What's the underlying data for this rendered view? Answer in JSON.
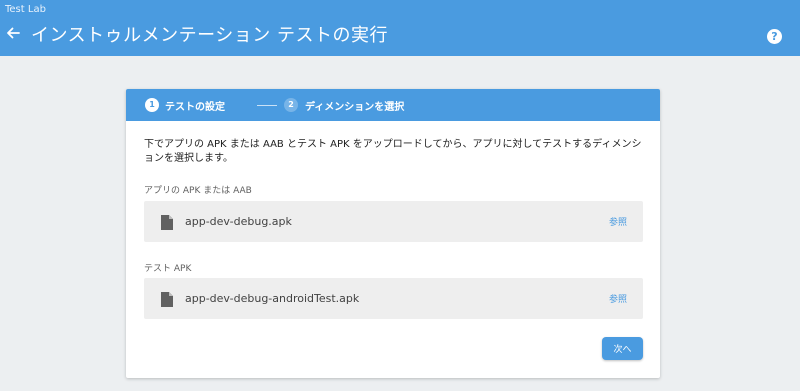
{
  "app": {
    "name": "Test Lab"
  },
  "header": {
    "title": "インストゥルメンテーション テストの実行",
    "back_icon": "arrow-left-icon",
    "help_icon": "help-icon",
    "help_glyph": "?"
  },
  "stepper": {
    "steps": [
      {
        "number": "1",
        "label": "テストの設定",
        "state": "active"
      },
      {
        "number": "2",
        "label": "ディメンションを選択",
        "state": "inactive"
      }
    ]
  },
  "form": {
    "description": "下でアプリの APK または AAB とテスト APK をアップロードしてから、アプリに対してテストするディメンションを選択します。",
    "app_field": {
      "label": "アプリの APK または AAB",
      "file_name": "app-dev-debug.apk",
      "browse_label": "参照",
      "icon": "file-icon"
    },
    "test_field": {
      "label": "テスト APK",
      "file_name": "app-dev-debug-androidTest.apk",
      "browse_label": "参照",
      "icon": "file-icon"
    },
    "next_label": "次へ"
  },
  "colors": {
    "accent": "#4a9be0",
    "background": "#eceff1",
    "file_row": "#eeeeee"
  }
}
